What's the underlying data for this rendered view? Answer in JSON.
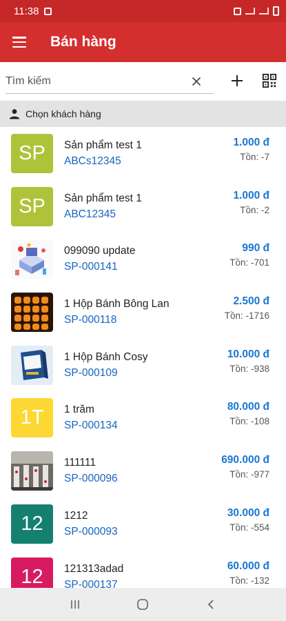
{
  "status_bar": {
    "time": "11:38"
  },
  "app_bar": {
    "title": "Bán hàng",
    "menu_icon": "hamburger-menu-icon"
  },
  "search": {
    "placeholder": "Tìm kiếm",
    "value": ""
  },
  "customer": {
    "label": "Chọn khách hàng",
    "icon": "person-icon"
  },
  "products": [
    {
      "initials": "SP",
      "color": "#afc33a",
      "name": " Sản phẩm test 1",
      "code": "ABCs12345",
      "price": "1.000 đ",
      "stock": "Tồn: -7"
    },
    {
      "initials": "SP",
      "color": "#afc33a",
      "name": " Sản phẩm test 1",
      "code": "ABC12345",
      "price": "1.000 đ",
      "stock": "Tồn: -2"
    },
    {
      "initials": "",
      "image": "isometric-illustration",
      "name": "099090 update",
      "code": "SP-000141",
      "price": "990 đ",
      "stock": "Tồn: -701"
    },
    {
      "initials": "",
      "image": "sponge-cake-photo",
      "name": "1 Hộp Bánh Bông Lan",
      "code": "SP-000118",
      "price": "2.500 đ",
      "stock": "Tồn: -1716"
    },
    {
      "initials": "",
      "image": "cosy-biscuit-box-photo",
      "name": "1 Hộp Bánh Cosy",
      "code": "SP-000109",
      "price": "10.000 đ",
      "stock": "Tồn: -938"
    },
    {
      "initials": "1T",
      "color": "#fdd835",
      "name": "1 trăm",
      "code": "SP-000134",
      "price": "80.000 đ",
      "stock": "Tồn: -108"
    },
    {
      "initials": "",
      "image": "factory-photo",
      "name": "111111",
      "code": "SP-000096",
      "price": "690.000 đ",
      "stock": "Tồn: -977"
    },
    {
      "initials": "12",
      "color": "#15806f",
      "name": "1212",
      "code": "SP-000093",
      "price": "30.000 đ",
      "stock": "Tồn: -554"
    },
    {
      "initials": "12",
      "color": "#d81b60",
      "name": "121313adad",
      "code": "SP-000137",
      "price": "60.000 đ",
      "stock": "Tồn: -132"
    }
  ],
  "colors": {
    "app_bar": "#d32f2f",
    "status_bar": "#c62828",
    "price": "#1976d2",
    "code": "#1565c0"
  }
}
